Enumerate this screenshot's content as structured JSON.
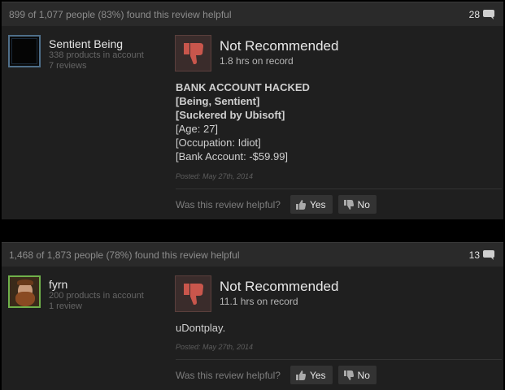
{
  "reviews": [
    {
      "helpful_summary": "899 of 1,077 people (83%) found this review helpful",
      "comment_count": "28",
      "author": {
        "name": "Sentient Being",
        "products": "338 products in account",
        "reviews": "7 reviews"
      },
      "rating": {
        "title": "Not Recommended",
        "hours": "1.8 hrs on record"
      },
      "content": [
        "BANK ACCOUNT HACKED",
        "[Being, Sentient]",
        "[Suckered by Ubisoft]",
        "[Age: 27]",
        "[Occupation: Idiot]",
        "[Bank Account: -$59.99]"
      ],
      "posted": "Posted: May 27th, 2014",
      "helpful_question": "Was this review helpful?",
      "yes_label": "Yes",
      "no_label": "No"
    },
    {
      "helpful_summary": "1,468 of 1,873 people (78%) found this review helpful",
      "comment_count": "13",
      "author": {
        "name": "fyrn",
        "products": "200 products in account",
        "reviews": "1 review"
      },
      "rating": {
        "title": "Not Recommended",
        "hours": "11.1 hrs on record"
      },
      "content": [
        "uDontplay."
      ],
      "posted": "Posted: May 27th, 2014",
      "helpful_question": "Was this review helpful?",
      "yes_label": "Yes",
      "no_label": "No"
    }
  ],
  "icons": {
    "comment": "speech-bubble-icon",
    "thumbs_down": "thumbs-down-icon",
    "vote_up": "thumbs-up-icon",
    "vote_down": "thumbs-down-icon"
  },
  "colors": {
    "thumb_down": "#c9564c",
    "panel": "#1f1f1f",
    "header": "#2a2a2a"
  }
}
